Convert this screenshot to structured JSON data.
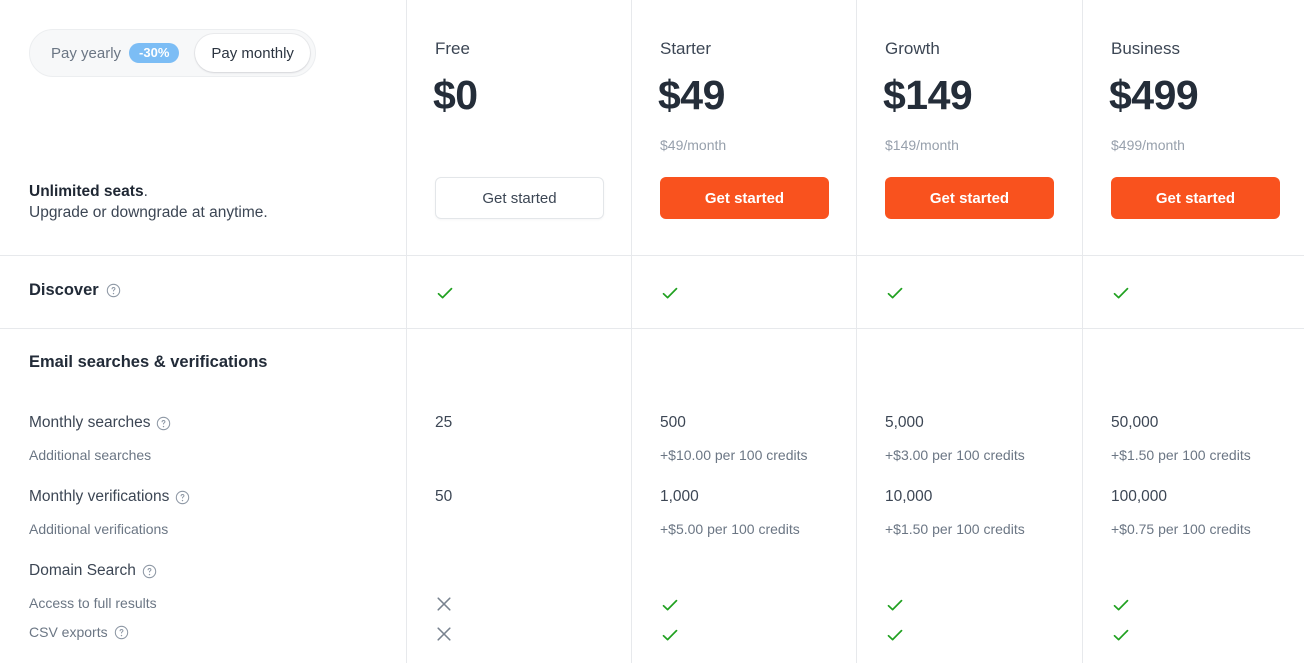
{
  "billing_toggle": {
    "yearly_label": "Pay yearly",
    "discount_badge": "-30%",
    "monthly_label": "Pay monthly",
    "selected": "Pay monthly",
    "badge_color": "#7cbdf5"
  },
  "seats_note": {
    "bold": "Unlimited seats",
    "bold_suffix": ".",
    "line2": "Upgrade or downgrade at anytime."
  },
  "plans": [
    {
      "name": "Free",
      "price": "$0",
      "sub": "",
      "cta": "Get started",
      "cta_style": "ghost"
    },
    {
      "name": "Starter",
      "price": "$49",
      "sub": "$49/month",
      "cta": "Get started",
      "cta_style": "solid"
    },
    {
      "name": "Growth",
      "price": "$149",
      "sub": "$149/month",
      "cta": "Get started",
      "cta_style": "solid"
    },
    {
      "name": "Business",
      "price": "$499",
      "sub": "$499/month",
      "cta": "Get started",
      "cta_style": "solid"
    }
  ],
  "discover_row": {
    "label": "Discover",
    "has_help": true,
    "values": [
      "check",
      "check",
      "check",
      "check"
    ]
  },
  "section": {
    "title": "Email searches & verifications",
    "rows": [
      {
        "label": "Monthly searches",
        "has_help": true,
        "sub_label": "Additional searches",
        "values": [
          "25",
          "500",
          "5,000",
          "50,000"
        ],
        "sub_values": [
          "",
          "+$10.00 per 100 credits",
          "+$3.00 per 100 credits",
          "+$1.50 per 100 credits"
        ]
      },
      {
        "label": "Monthly verifications",
        "has_help": true,
        "sub_label": "Additional verifications",
        "values": [
          "50",
          "1,000",
          "10,000",
          "100,000"
        ],
        "sub_values": [
          "",
          "+$5.00 per 100 credits",
          "+$1.50 per 100 credits",
          "+$0.75 per 100 credits"
        ]
      }
    ],
    "domain_search": {
      "label": "Domain Search",
      "has_help": true,
      "sub_rows": [
        {
          "label": "Access to full results",
          "has_help": false,
          "values": [
            "cross",
            "check",
            "check",
            "check"
          ]
        },
        {
          "label": "CSV exports",
          "has_help": true,
          "values": [
            "cross",
            "check",
            "check",
            "check"
          ]
        }
      ]
    }
  },
  "colors": {
    "accent_orange": "#f9521e",
    "check_green": "#21a121",
    "cross_gray": "#78828f",
    "divider": "#e7e9ec"
  }
}
